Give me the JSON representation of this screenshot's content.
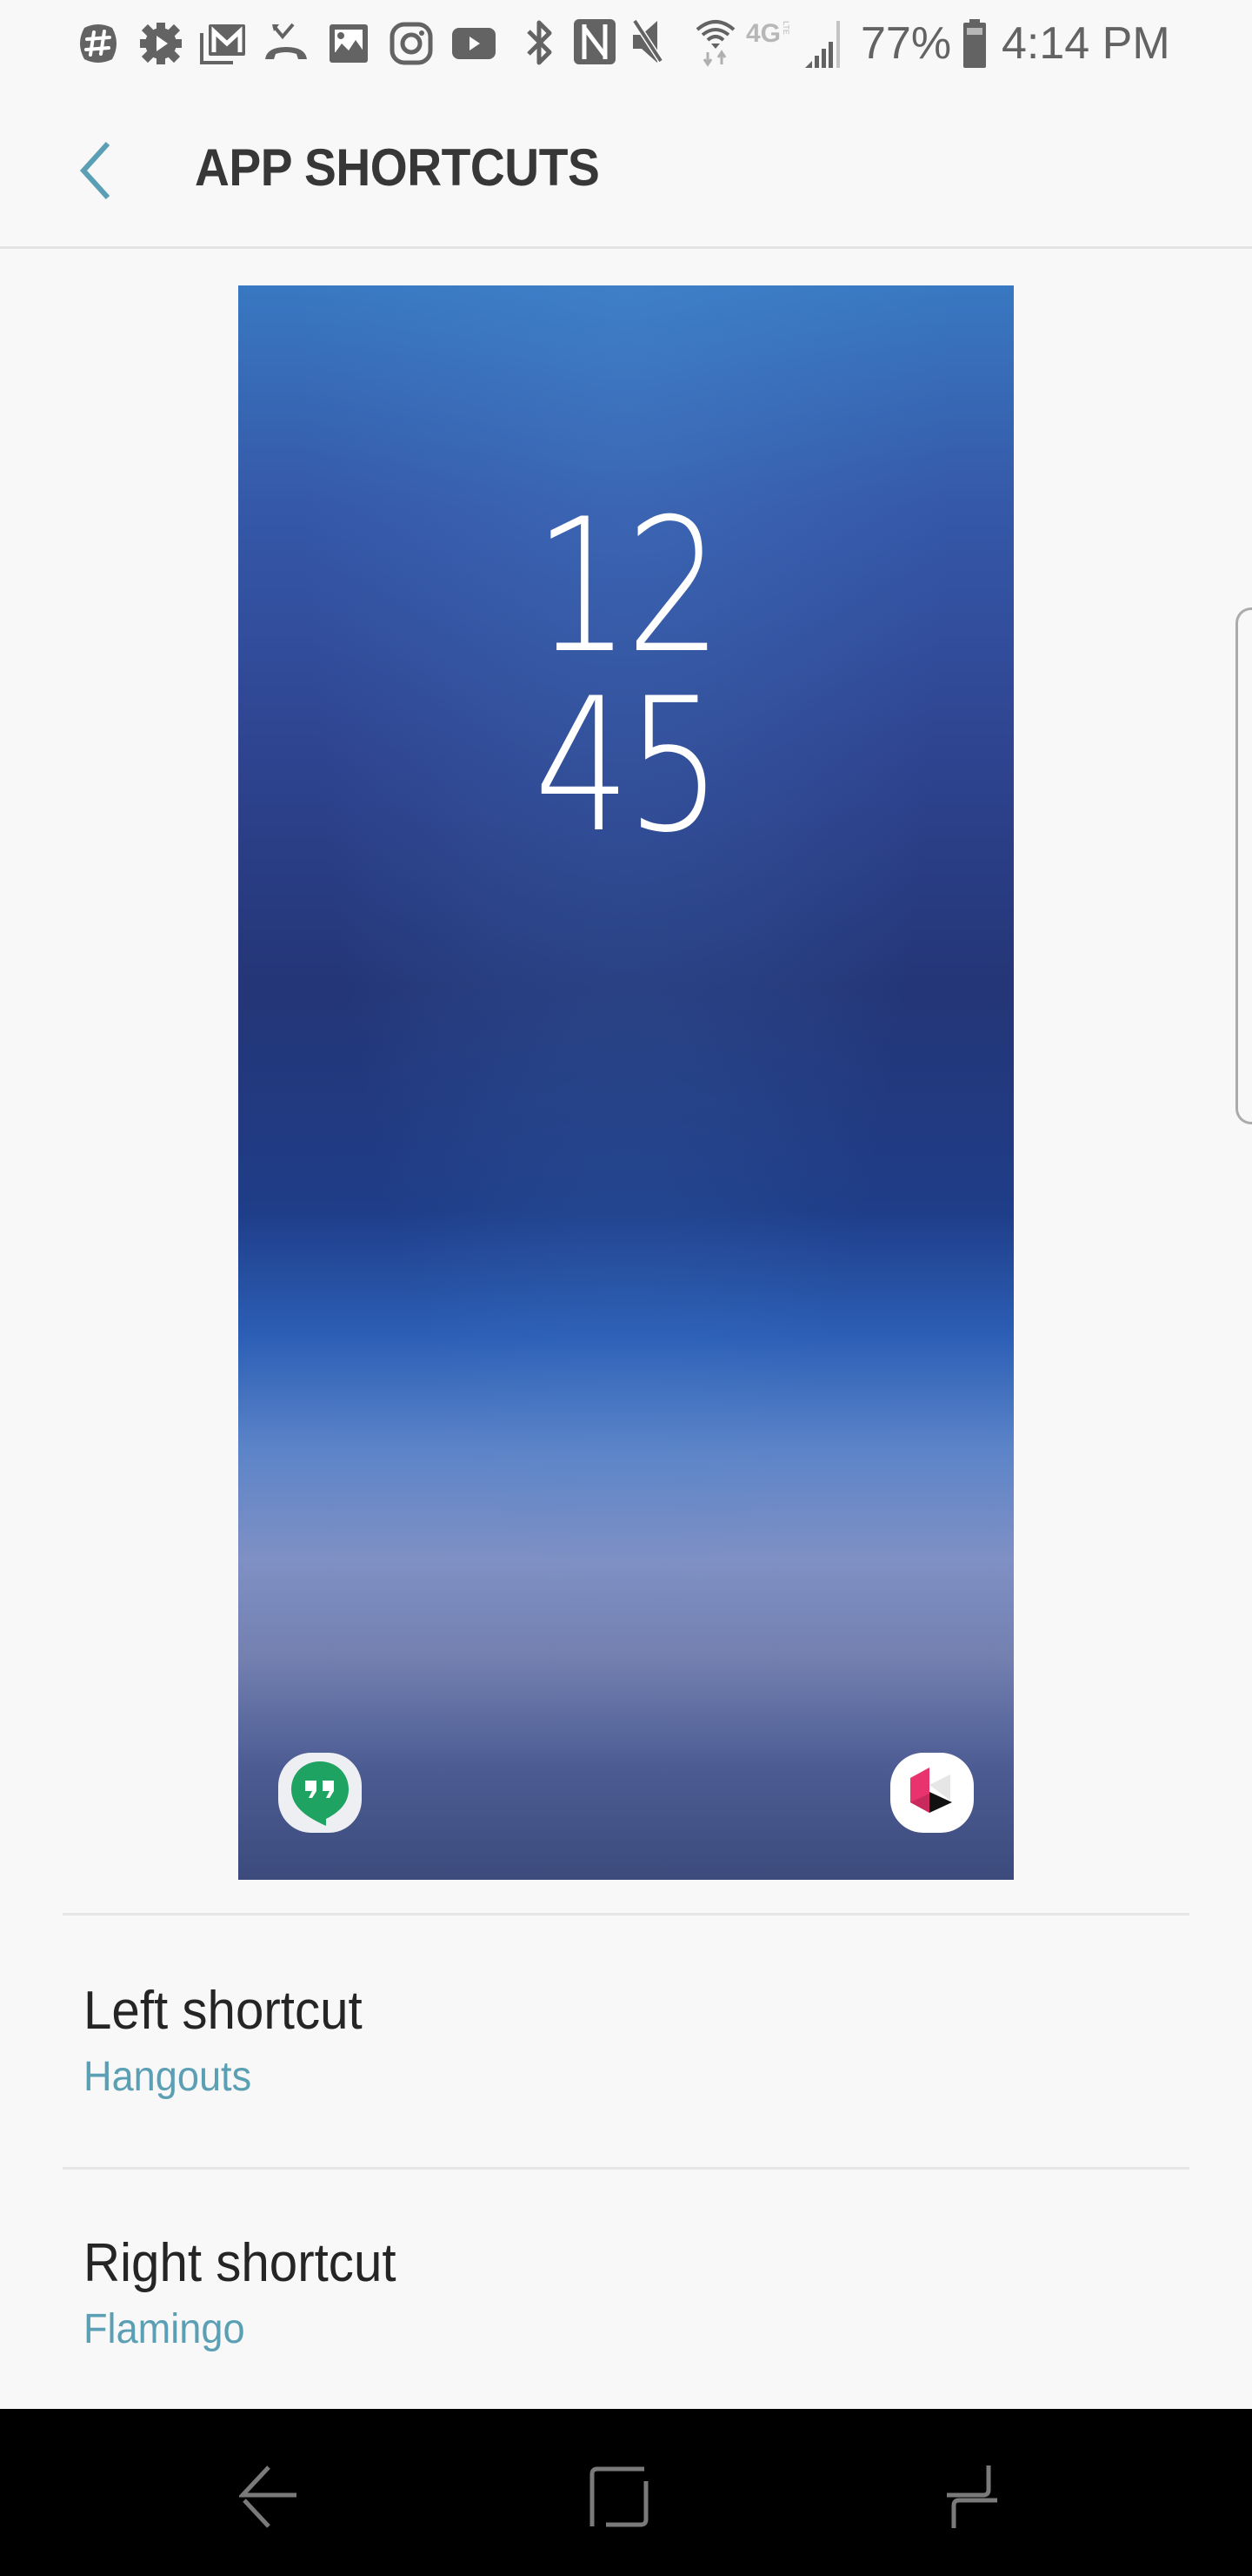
{
  "status_bar": {
    "notification_icons": [
      "slack-icon",
      "google-play-games-icon",
      "gmail-icon",
      "missed-call-icon",
      "gallery-icon",
      "instagram-icon",
      "youtube-icon"
    ],
    "system_icons": [
      "bluetooth-icon",
      "nfc-icon",
      "mute-icon",
      "wifi-icon",
      "lte-icon",
      "signal-icon"
    ],
    "network_label": "4G",
    "network_sub": "LTE",
    "battery_percent": "77%",
    "time": "4:14 PM"
  },
  "header": {
    "back_label": "Navigate up",
    "title": "APP SHORTCUTS"
  },
  "preview": {
    "clock_hours": "12",
    "clock_minutes": "45",
    "left_app": "Hangouts",
    "right_app": "Flamingo",
    "colors": {
      "hangouts_green": "#1ea362",
      "flamingo_pink": "#e8336e"
    }
  },
  "settings": [
    {
      "title": "Left shortcut",
      "value": "Hangouts"
    },
    {
      "title": "Right shortcut",
      "value": "Flamingo"
    }
  ],
  "colors": {
    "accent": "#5a9fb4",
    "title_text": "#373737",
    "background": "#f8f8f8"
  },
  "nav_bar": {
    "back": "Back",
    "home": "Home",
    "recents": "Recent apps"
  }
}
